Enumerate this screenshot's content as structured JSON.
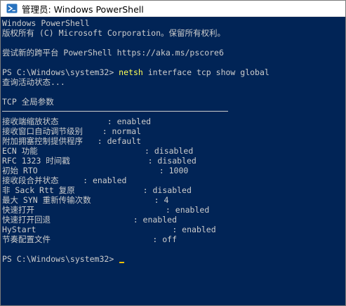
{
  "window": {
    "title": "管理员: Windows PowerShell",
    "icon": "powershell-icon",
    "bg": "#012456",
    "accent_command": "#ffff55"
  },
  "console": {
    "banner": [
      "Windows PowerShell",
      "版权所有 (C) Microsoft Corporation。保留所有权利。",
      "",
      "尝试新的跨平台 PowerShell https://aka.ms/pscore6",
      ""
    ],
    "prompt": "PS C:\\Windows\\system32> ",
    "command": {
      "verb": "netsh",
      "args": " interface tcp show global"
    },
    "querying": "查询活动状态...",
    "section_title": "TCP 全局参数",
    "params": [
      "接收端缩放状态          : enabled",
      "接收窗口自动调节级别    : normal",
      "附加拥塞控制提供程序   : default",
      "ECN 功能                      : disabled",
      "RFC 1323 时间戳                : disabled",
      "初始 RTO                         : 1000",
      "接收段合并状态     : enabled",
      "非 Sack Rtt 复原              : disabled",
      "最大 SYN 重新传输次数             : 4",
      "快速打开                           : enabled",
      "快速打开回退                 : enabled",
      "HyStart                            : enabled",
      "节奏配置文件                     : off"
    ],
    "final_prompt": "PS C:\\Windows\\system32> "
  }
}
